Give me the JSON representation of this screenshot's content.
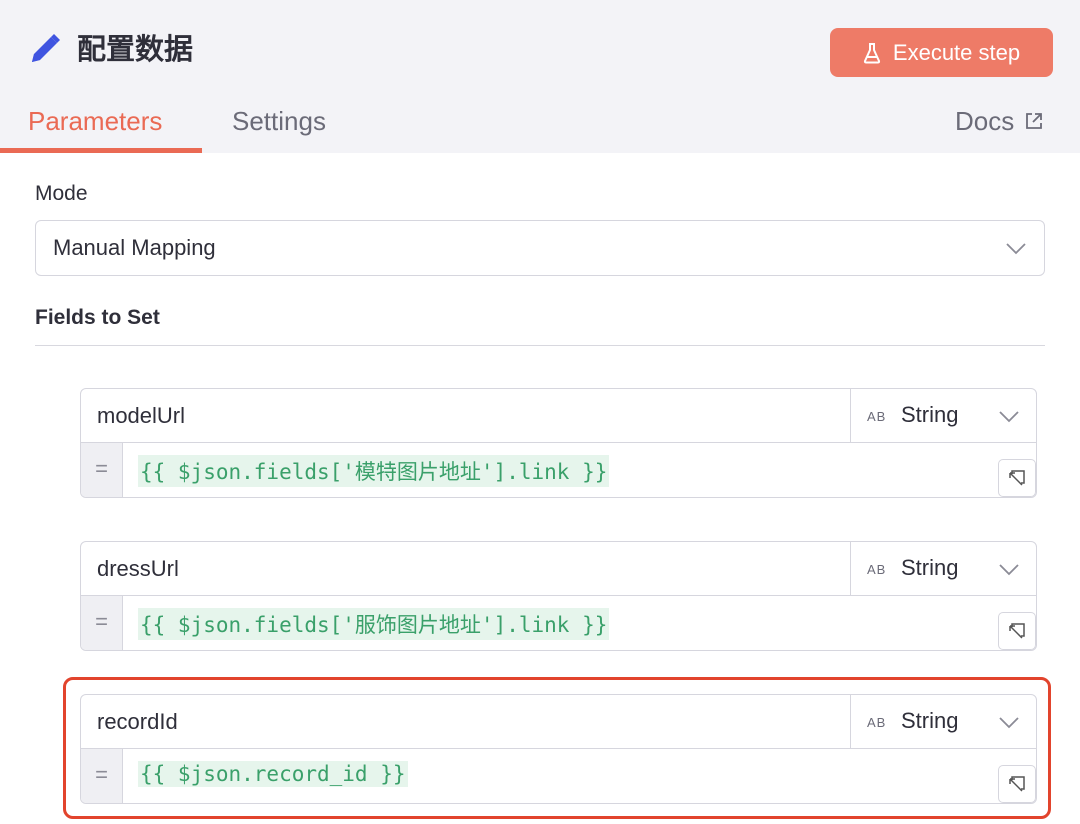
{
  "header": {
    "title": "配置数据",
    "execute_label": "Execute step",
    "tabs": [
      {
        "label": "Parameters",
        "active": true
      },
      {
        "label": "Settings",
        "active": false
      }
    ],
    "docs_label": "Docs"
  },
  "mode": {
    "label": "Mode",
    "value": "Manual Mapping"
  },
  "fields_to_set": {
    "label": "Fields to Set",
    "items": [
      {
        "name": "modelUrl",
        "type_badge": "AB",
        "type": "String",
        "eq": "=",
        "value": "{{ $json.fields['模特图片地址'].link }}"
      },
      {
        "name": "dressUrl",
        "type_badge": "AB",
        "type": "String",
        "eq": "=",
        "value": "{{ $json.fields['服饰图片地址'].link }}"
      },
      {
        "name": "recordId",
        "type_badge": "AB",
        "type": "String",
        "eq": "=",
        "value": "{{ $json.record_id }}",
        "highlighted": true
      }
    ]
  },
  "colors": {
    "accent": "#ea6a54",
    "execute_button": "#ee7b67",
    "pencil_icon": "#3f54e0",
    "expression_text": "#3aa06a",
    "highlight_border": "#e2442d"
  },
  "icons": [
    "pencil-icon",
    "flask-icon",
    "external-link-icon",
    "chevron-down-icon",
    "open-expression-icon"
  ]
}
